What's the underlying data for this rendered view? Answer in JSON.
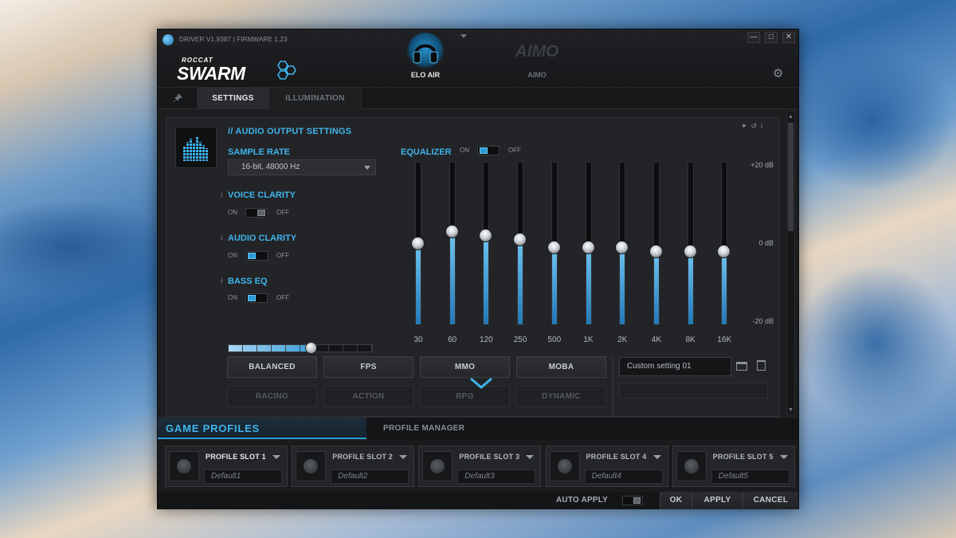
{
  "window": {
    "version": "DRIVER V1.9387 | FIRMWARE 1.23",
    "logo_small": "ROCCAT",
    "logo_big": "SWARM",
    "minimize": "—",
    "maximize": "□",
    "close": "✕",
    "settings_icon": "gear-icon"
  },
  "devices": [
    {
      "label": "ELO AIR",
      "icon": "headset-icon",
      "active": true
    },
    {
      "label": "AIMO",
      "logo": "AIMO",
      "active": false
    }
  ],
  "tabs": {
    "pin": "★",
    "settings": "SETTINGS",
    "illumination": "ILLUMINATION"
  },
  "audio": {
    "section_title": "// AUDIO OUTPUT SETTINGS",
    "sample_rate_label": "SAMPLE RATE",
    "sample_rate_value": "16-bit, 48000 Hz",
    "voice_clarity": {
      "label": "VOICE CLARITY",
      "on": "ON",
      "off": "OFF",
      "state": "off"
    },
    "audio_clarity": {
      "label": "AUDIO CLARITY",
      "on": "ON",
      "off": "OFF",
      "state": "on"
    },
    "bass_eq": {
      "label": "BASS EQ",
      "on": "ON",
      "off": "OFF",
      "state": "on"
    },
    "bass_level": {
      "value": 6,
      "scale": [
        "1",
        "2",
        "3",
        "4",
        "5",
        "6",
        "7",
        "8",
        "9",
        "10"
      ]
    },
    "info": "i"
  },
  "equalizer": {
    "label": "EQUALIZER",
    "on": "ON",
    "off": "OFF",
    "state": "on",
    "db_labels": [
      "+20 dB",
      "0 dB",
      "-20 dB"
    ],
    "range": [
      -20,
      20
    ],
    "bands": [
      {
        "freq": "30",
        "db": 0
      },
      {
        "freq": "60",
        "db": 3
      },
      {
        "freq": "120",
        "db": 2
      },
      {
        "freq": "250",
        "db": 1
      },
      {
        "freq": "500",
        "db": -1
      },
      {
        "freq": "1K",
        "db": -1
      },
      {
        "freq": "2K",
        "db": -1
      },
      {
        "freq": "4K",
        "db": -2
      },
      {
        "freq": "8K",
        "db": -2
      },
      {
        "freq": "16K",
        "db": -2
      }
    ]
  },
  "presets": {
    "row1": [
      "BALANCED",
      "FPS",
      "MMO",
      "MOBA"
    ],
    "row2": [
      "RACING",
      "ACTION",
      "RPG",
      "DYNAMIC"
    ],
    "custom_name": "Custom setting 01"
  },
  "game_profiles": {
    "title": "GAME PROFILES",
    "manager": "PROFILE MANAGER",
    "slots": [
      {
        "name": "PROFILE SLOT 1",
        "value": "Default1",
        "active": true
      },
      {
        "name": "PROFILE SLOT 2",
        "value": "Default2",
        "active": false
      },
      {
        "name": "PROFILE SLOT 3",
        "value": "Default3",
        "active": false
      },
      {
        "name": "PROFILE SLOT 4",
        "value": "Default4",
        "active": false
      },
      {
        "name": "PROFILE SLOT 5",
        "value": "Default5",
        "active": false
      }
    ]
  },
  "footer": {
    "auto_apply": "AUTO APPLY",
    "ok": "OK",
    "apply": "APPLY",
    "cancel": "CANCEL"
  }
}
